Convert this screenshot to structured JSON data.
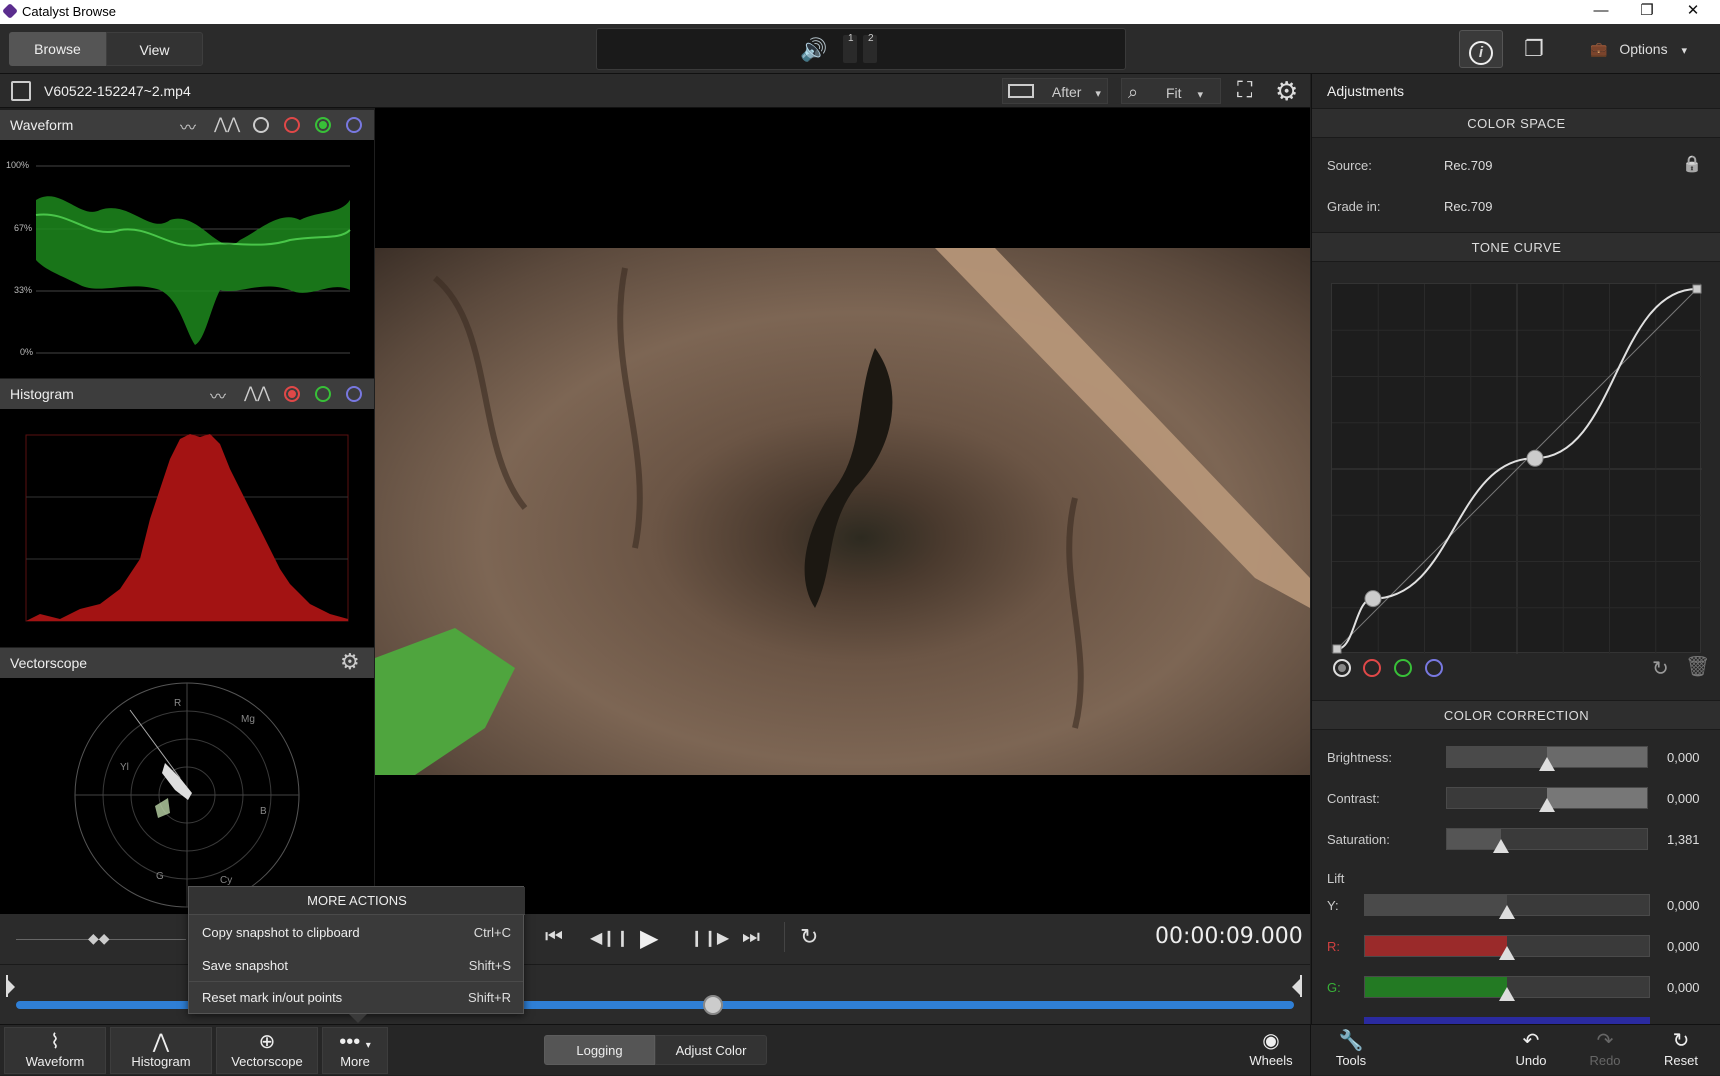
{
  "window": {
    "title": "Catalyst Browse",
    "minimize": "—",
    "maximize": "❐",
    "close": "✕"
  },
  "toolbar": {
    "browse_label": "Browse",
    "view_label": "View",
    "audio_icon": "🔊",
    "meter1": "1",
    "meter2": "2",
    "info_icon": "i",
    "windows_icon": "❐",
    "options_label": "Options",
    "options_icon": "💼",
    "options_caret": "▾"
  },
  "filebar": {
    "filename": "V60522-152247~2.mp4",
    "compare_mode": "After",
    "zoom": "Fit",
    "caret": "▾",
    "fullscreen_icon": "⛶",
    "settings_icon": "⚙",
    "search_icon": "⌕"
  },
  "scopes": {
    "waveform": {
      "title": "Waveform",
      "labels": [
        "100%",
        "67%",
        "33%",
        "0%"
      ]
    },
    "histogram": {
      "title": "Histogram"
    },
    "vectorscope": {
      "title": "Vectorscope",
      "labels": {
        "R": "R",
        "Mg": "Mg",
        "Yl": "Yl",
        "B": "B",
        "G": "G",
        "Cy": "Cy"
      }
    }
  },
  "transport": {
    "timecode": "00:00:09.000",
    "prev": "⏮",
    "step_back": "◀❙❙",
    "play": "▶",
    "step_fwd": "❙❙▶",
    "next": "⏭",
    "loop": "↻"
  },
  "timeline": {
    "playhead_fraction": 0.545
  },
  "popup": {
    "header": "MORE ACTIONS",
    "items": [
      {
        "label": "Copy snapshot to clipboard",
        "shortcut": "Ctrl+C"
      },
      {
        "label": "Save snapshot",
        "shortcut": "Shift+S"
      },
      {
        "label": "Reset mark in/out points",
        "shortcut": "Shift+R"
      }
    ]
  },
  "bottombar": {
    "waveform": "Waveform",
    "histogram": "Histogram",
    "vectorscope": "Vectorscope",
    "more": "More",
    "more_icon": "•••",
    "more_caret": "▾",
    "logging": "Logging",
    "adjust_color": "Adjust Color",
    "wheels": "Wheels",
    "tools": "Tools",
    "undo": "Undo",
    "redo": "Redo",
    "reset": "Reset"
  },
  "adjustments": {
    "title": "Adjustments",
    "color_space": {
      "header": "COLOR SPACE",
      "source_label": "Source:",
      "source_value": "Rec.709",
      "grade_label": "Grade in:",
      "grade_value": "Rec.709",
      "lock_icon": "🔒"
    },
    "tone_curve": {
      "header": "TONE CURVE",
      "points": [
        [
          0,
          0
        ],
        [
          0.1,
          0.14
        ],
        [
          0.55,
          0.53
        ],
        [
          1,
          1
        ]
      ]
    },
    "color_correction": {
      "header": "COLOR CORRECTION",
      "brightness": {
        "label": "Brightness:",
        "value": "0,000",
        "level": 0.5
      },
      "contrast": {
        "label": "Contrast:",
        "value": "0,000",
        "level": 0.5
      },
      "saturation": {
        "label": "Saturation:",
        "value": "1,381",
        "level": 0.27
      }
    },
    "lift": {
      "label": "Lift",
      "y": {
        "label": "Y:",
        "value": "0,000",
        "level": 0.5
      },
      "r": {
        "label": "R:",
        "value": "0,000",
        "level": 0.5
      },
      "g": {
        "label": "G:",
        "value": "0,000",
        "level": 0.5
      }
    }
  },
  "colors": {
    "accent": "#2f7fd6",
    "red": "#e04848",
    "green": "#38c038",
    "blue": "#7878e0"
  }
}
